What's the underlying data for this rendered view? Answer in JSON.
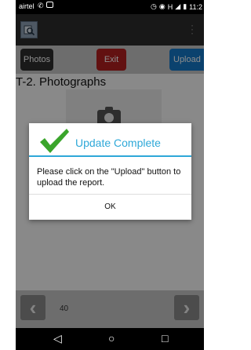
{
  "status_bar": {
    "carrier": "airtel",
    "network_type": "H",
    "time": "11:2",
    "icons": [
      "whatsapp-icon",
      "image-notification-icon",
      "alarm-icon",
      "vibrate-icon",
      "signal-icon",
      "battery-icon"
    ]
  },
  "app_bar": {
    "icons": [
      "app-logo-icon",
      "overflow-menu-icon"
    ]
  },
  "toolbar": {
    "photos_label": "Photos",
    "exit_label": "Exit",
    "upload_label": "Upload",
    "photos_color": "#2e2e2e",
    "exit_color": "#b22020",
    "upload_color": "#1479c9"
  },
  "section": {
    "title": "T-2. Photographs"
  },
  "footer": {
    "page_number": "40",
    "icons": [
      "prev-arrow-icon",
      "next-arrow-icon"
    ]
  },
  "dialog": {
    "title": "Update Complete",
    "message": "Please click on the \"Upload\" button to upload the report.",
    "ok_label": "OK",
    "accent_color": "#2ea8d8",
    "check_color": "#3aa52b"
  },
  "nav_bar": {
    "back": "◁",
    "home": "○",
    "recents": "□"
  }
}
